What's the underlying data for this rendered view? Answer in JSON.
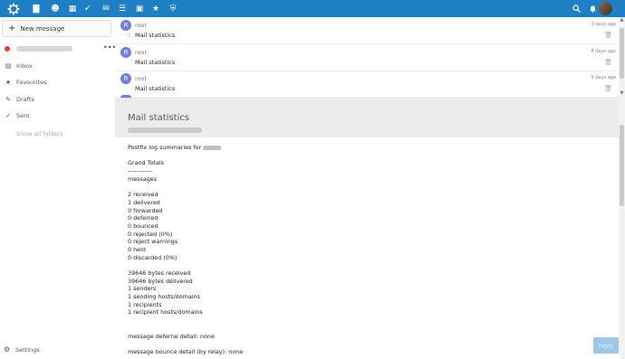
{
  "topbar": {
    "apps": [
      {
        "icon": "files-icon",
        "glyph": "▇"
      },
      {
        "icon": "contacts-icon",
        "glyph": "☻"
      },
      {
        "icon": "calendar-icon",
        "glyph": "▦"
      },
      {
        "icon": "tasks-icon",
        "glyph": "✓"
      },
      {
        "icon": "mail-icon",
        "glyph": "✉"
      },
      {
        "icon": "notes-icon",
        "glyph": "☰"
      },
      {
        "icon": "gallery-icon",
        "glyph": "▣"
      },
      {
        "icon": "favorites-icon",
        "glyph": "★"
      },
      {
        "icon": "shield-icon",
        "glyph": "⛨"
      }
    ],
    "accent": "#1f7fc5"
  },
  "sidebar": {
    "new_message": "New message",
    "account_more": "•••",
    "folders": [
      {
        "label": "Inbox",
        "icon": "inbox-icon",
        "glyph": "▤"
      },
      {
        "label": "Favourites",
        "icon": "star-icon",
        "glyph": "★"
      },
      {
        "label": "Drafts",
        "icon": "pencil-icon",
        "glyph": "✎"
      },
      {
        "label": "Sent",
        "icon": "check-icon",
        "glyph": "✓"
      }
    ],
    "show_all": "Show all folders",
    "settings": "Settings"
  },
  "messages": [
    {
      "avatar": "R",
      "from": "root",
      "subject": "Mail statistics",
      "date": "3 days ago"
    },
    {
      "avatar": "R",
      "from": "root",
      "subject": "Mail statistics",
      "date": "8 days ago"
    },
    {
      "avatar": "R",
      "from": "root",
      "subject": "Mail statistics",
      "date": "9 days ago"
    }
  ],
  "viewer": {
    "title": "Mail statistics",
    "body": {
      "intro": "Postfix log summaries for",
      "grand_totals": "Grand Totals",
      "separator": "------------",
      "messages_label": "messages",
      "stats": [
        "2 received",
        "1 delivered",
        "0 forwarded",
        "0 deferred",
        "0 bounced",
        "0 rejected (0%)",
        "0 reject warnings",
        "0 held",
        "0 discarded (0%)"
      ],
      "bytes": [
        "39646 bytes received",
        "39646 bytes delivered",
        "1 senders",
        "1 sending hosts/domains",
        "1 recipients",
        "1 recipient hosts/domains"
      ],
      "deferral": "message deferral detail: none",
      "bounce": "message bounce detail (by relay): none"
    },
    "reply": "Reply"
  }
}
